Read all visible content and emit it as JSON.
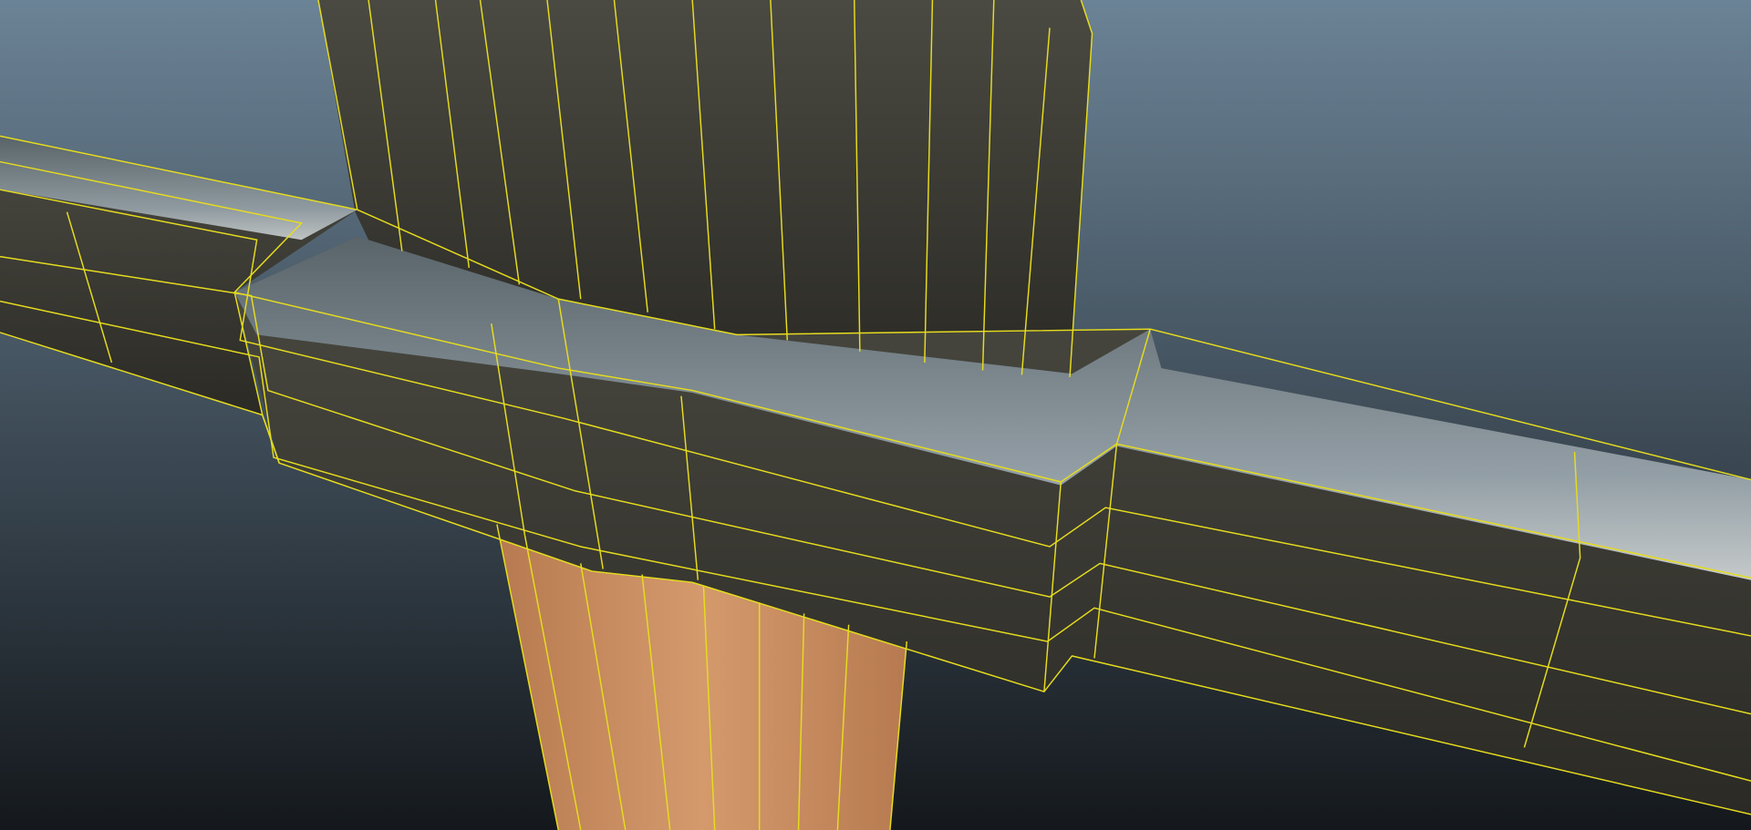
{
  "viewport": {
    "background_top": "#6b8396",
    "background_bottom": "#14181c",
    "wireframe_color": "#e6dc1e",
    "metal_dark": "#34332d",
    "metal_light": "#9fb0bb",
    "grip_color": "#b77a50",
    "grip_light": "#d49a6c"
  }
}
